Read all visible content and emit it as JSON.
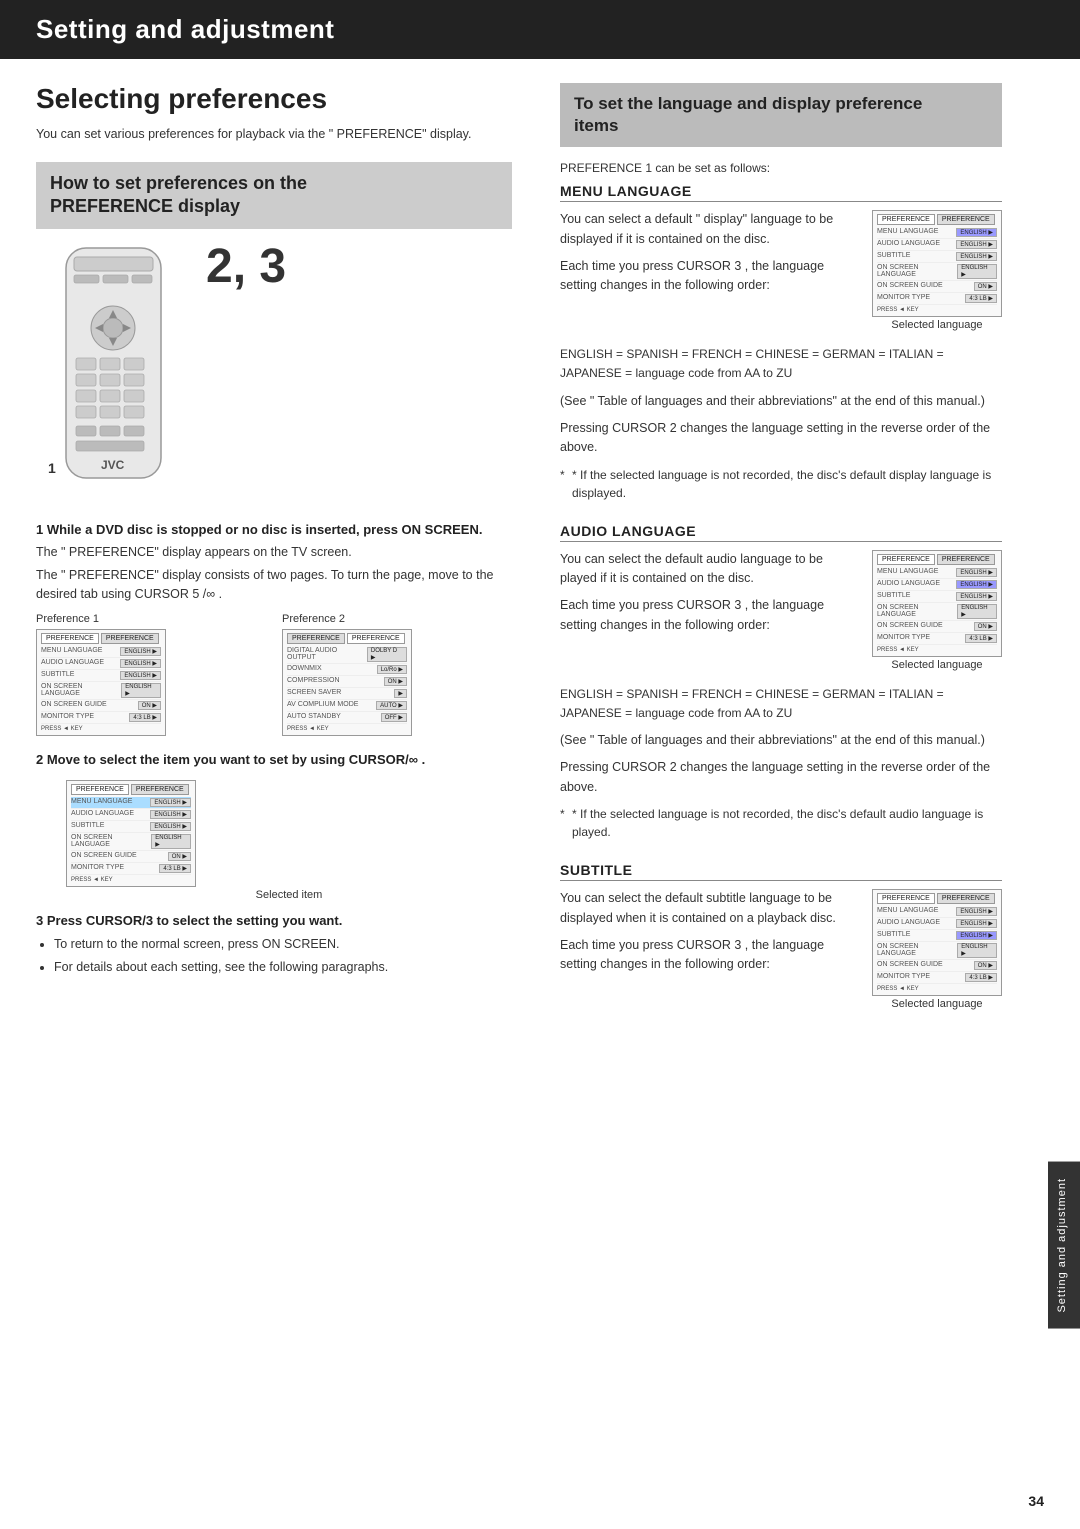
{
  "header": {
    "title": "Setting and adjustment"
  },
  "left": {
    "page_title": "Selecting preferences",
    "intro": "You can set various preferences for playback via the \" PREFERENCE\" display.",
    "subsection_box": {
      "line1": "How to set preferences on the",
      "line2": "PREFERENCE  display"
    },
    "step_number_big": "2, 3",
    "step_number_small": "1",
    "step1": {
      "label": "1  While a DVD disc is stopped or no disc is inserted, press ON SCREEN.",
      "body1": "The \" PREFERENCE\" display appears on the TV screen.",
      "body2": "The \" PREFERENCE\" display consists of two pages. To turn the page, move      to the desired tab using CURSOR 5 /∞ ."
    },
    "pref_displays": {
      "label1": "Preference 1",
      "label2": "Preference 2"
    },
    "pref1_rows": [
      {
        "label": "MENU LANGUAGE",
        "value": "ENGLISH"
      },
      {
        "label": "AUDIO LANGUAGE",
        "value": "ENGLISH"
      },
      {
        "label": "SUBTITLE",
        "value": "ENGLISH"
      },
      {
        "label": "ON SCREEN LANGUAGE",
        "value": "ENGLISH"
      },
      {
        "label": "ON SCREEN GUIDE",
        "value": "ON"
      },
      {
        "label": "MONITOR TYPE",
        "value": "4:3 LB"
      }
    ],
    "pref1_footer": "PRESS  ◄ KEY",
    "pref2_rows": [
      {
        "label": "DIGITAL AUDIO OUTPUT",
        "value": "DOLBY D"
      },
      {
        "label": "DOWNMIX",
        "value": "Lo/Ro"
      },
      {
        "label": "COMPRESSION",
        "value": "ON"
      },
      {
        "label": "SCREEN SAVER",
        "value": ""
      },
      {
        "label": "AV COMPLIUM MODE",
        "value": "AUTO"
      },
      {
        "label": "AUTO STANDBY",
        "value": "OFF"
      }
    ],
    "pref2_footer": "PRESS  ◄ KEY",
    "step2": {
      "label": "2  Move      to select the item you want to set by using CURSOR/∞ .",
      "selected_caption": "Selected item"
    },
    "selected_rows": [
      {
        "label": "MENU LANGUAGE",
        "value": "ENGLISH"
      },
      {
        "label": "AUDIO LANGUAGE",
        "value": "ENGLISH"
      },
      {
        "label": "SUBTITLE",
        "value": "ENGLISH"
      },
      {
        "label": "ON SCREEN LANGUAGE",
        "value": "ENGLISH"
      },
      {
        "label": "ON SCREEN GUIDE",
        "value": "ON"
      },
      {
        "label": "MONITOR TYPE",
        "value": "4:3 LB"
      }
    ],
    "step3": {
      "label": "3  Press CURSOR/3  to select the setting you want.",
      "bullets": [
        "To return to the normal screen, press ON SCREEN.",
        "For details about each setting, see the following paragraphs."
      ]
    }
  },
  "right": {
    "section_box": {
      "line1": "To set the language and display preference",
      "line2": "items"
    },
    "pref1_label": "PREFERENCE 1 can be set as follows:",
    "menu_language": {
      "heading": "MENU LANGUAGE",
      "body1": "You can select a default \" display\" language to be displayed if it is contained on the disc.",
      "body2": "Each time you press CURSOR 3 , the language setting changes in the following order:",
      "sequence": "ENGLISH = SPANISH = FRENCH = CHINESE = GERMAN = ITALIAN = JAPANESE = language code from AA to ZU",
      "note1": "(See \" Table of languages and their abbreviations\" at the end of this manual.)",
      "body3": "Pressing CURSOR 2 changes the language setting in the reverse order of the above.",
      "asterisk": "* If the selected language is not recorded, the disc's default display language is displayed.",
      "img_caption": "Selected language"
    },
    "audio_language": {
      "heading": "AUDIO LANGUAGE",
      "body1": "You can select the default audio language to be played if it is contained on the disc.",
      "body2": "Each time you press CURSOR 3 , the language setting changes in the following order:",
      "sequence": "ENGLISH = SPANISH = FRENCH = CHINESE = GERMAN = ITALIAN = JAPANESE = language code from AA to ZU",
      "note1": "(See \" Table of languages and their abbreviations\" at the end of this manual.)",
      "body3": "Pressing CURSOR 2 changes the language setting in the reverse order of the above.",
      "asterisk": "* If the selected language is not recorded, the disc's default audio language is played.",
      "img_caption": "Selected language"
    },
    "subtitle": {
      "heading": "SUBTITLE",
      "body1": "You can select the default subtitle language to be displayed when it is contained on a playback disc.",
      "body2": "Each time you press CURSOR 3 , the language setting changes in the following order:",
      "img_caption": "Selected language"
    }
  },
  "side_tab": {
    "line1": "Setting and",
    "line2": "adjustment"
  },
  "page_number": "34"
}
